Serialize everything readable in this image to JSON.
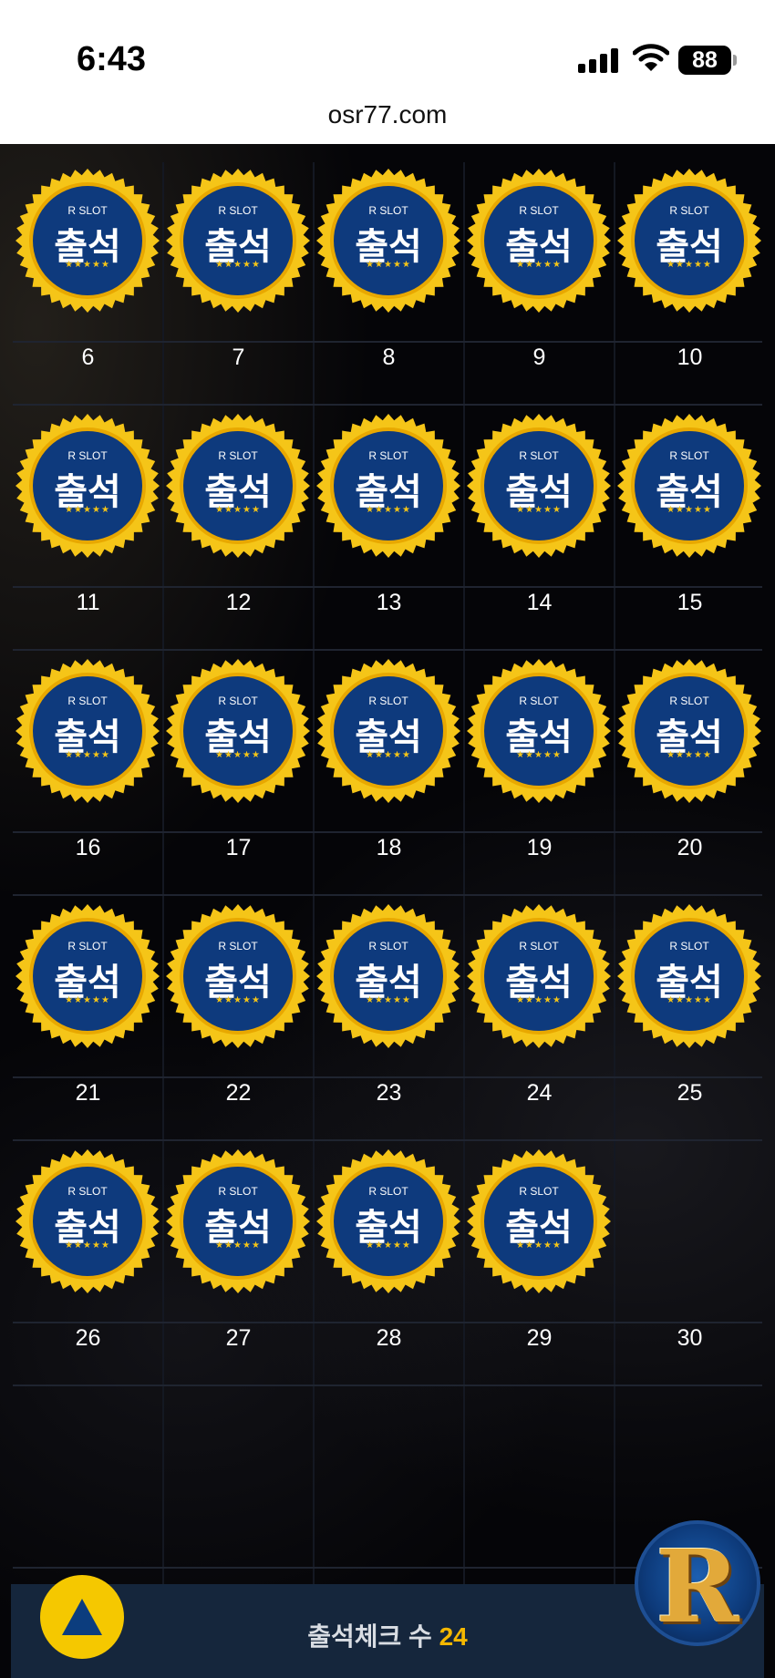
{
  "status_bar": {
    "time": "6:43",
    "battery": "88"
  },
  "browser": {
    "url": "osr77.com"
  },
  "badge": {
    "label": "R SLOT",
    "text": "출석",
    "stars": "★★★★★"
  },
  "calendar": {
    "rows": [
      {
        "days": [
          "6",
          "7",
          "8",
          "9",
          "10"
        ],
        "stamped": [
          true,
          true,
          true,
          true,
          true
        ]
      },
      {
        "days": [
          "11",
          "12",
          "13",
          "14",
          "15"
        ],
        "stamped": [
          true,
          true,
          true,
          true,
          true
        ]
      },
      {
        "days": [
          "16",
          "17",
          "18",
          "19",
          "20"
        ],
        "stamped": [
          true,
          true,
          true,
          true,
          true
        ]
      },
      {
        "days": [
          "21",
          "22",
          "23",
          "24",
          "25"
        ],
        "stamped": [
          true,
          true,
          true,
          true,
          true
        ]
      },
      {
        "days": [
          "26",
          "27",
          "28",
          "29",
          "30"
        ],
        "stamped": [
          true,
          true,
          true,
          true,
          false
        ]
      },
      {
        "days": [
          "",
          "",
          "",
          "",
          ""
        ],
        "stamped": [
          false,
          false,
          false,
          false,
          false
        ]
      }
    ]
  },
  "footer": {
    "label": "출석체크 수",
    "count": "24"
  },
  "colors": {
    "badge_gold": "#f5c518",
    "badge_blue": "#0e3a7d",
    "footer_bg": "#15263c",
    "count_color": "#f5b800"
  },
  "icons": {
    "scroll_top": "triangle-up-icon",
    "brand": "r-logo-icon"
  }
}
